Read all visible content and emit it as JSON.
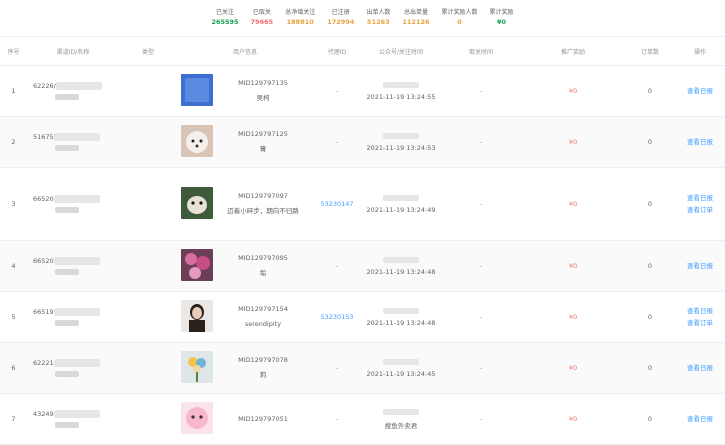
{
  "stats": [
    {
      "label": "已关注",
      "value": "265595",
      "color": "#14a44d"
    },
    {
      "label": "已取关",
      "value": "79665",
      "color": "#f56c6c"
    },
    {
      "label": "总净增关注",
      "value": "188810",
      "color": "#e6a23c"
    },
    {
      "label": "已注册",
      "value": "172994",
      "color": "#e6a23c"
    },
    {
      "label": "出单人数",
      "value": "51263",
      "color": "#e6a23c"
    },
    {
      "label": "总出单量",
      "value": "112126",
      "color": "#e6a23c"
    },
    {
      "label": "累计奖励人数",
      "value": "0",
      "color": "#e6a23c"
    },
    {
      "label": "累计奖励",
      "value": "¥0",
      "color": "#14a44d"
    }
  ],
  "columns": [
    "序号",
    "渠道ID/名称",
    "类型",
    "用户信息",
    "代理ID",
    "公众号/关注时间",
    "取关时间",
    "推广奖励",
    "订单数",
    "操作"
  ],
  "rows": [
    {
      "idx": "1",
      "cid": "62226/",
      "uid": "MID129797135",
      "uname": "吴柯",
      "agent": "-",
      "time": "2021-11-19 13:24:55",
      "unfollow": "-",
      "reward": "¥0",
      "orders": "0",
      "ops": [
        "查看日报"
      ],
      "avatar": "blue"
    },
    {
      "idx": "2",
      "cid": "51675",
      "uid": "MID129797125",
      "uname": "箐",
      "agent": "-",
      "time": "2021-11-19 13:24:53",
      "unfollow": "-",
      "reward": "¥0",
      "orders": "0",
      "ops": [
        "查看日报"
      ],
      "avatar": "dog"
    },
    {
      "idx": "3",
      "cid": "66520",
      "uid": "MID129797097",
      "uname": "迈着小碎步，期向不归路",
      "agent": "53230147",
      "time": "2021-11-19 13:24:49",
      "unfollow": "-",
      "reward": "¥0",
      "orders": "0",
      "ops": [
        "查看日报",
        "查看订单"
      ],
      "avatar": "cat"
    },
    {
      "idx": "4",
      "cid": "66520",
      "uid": "MID129797095",
      "uname": "垢",
      "agent": "-",
      "time": "2021-11-19 13:24:48",
      "unfollow": "-",
      "reward": "¥0",
      "orders": "0",
      "ops": [
        "查看日报"
      ],
      "avatar": "flower"
    },
    {
      "idx": "5",
      "cid": "66519",
      "uid": "MID129797154",
      "uname": "serendipity",
      "agent": "53230153",
      "time": "2021-11-19 13:24:48",
      "unfollow": "-",
      "reward": "¥0",
      "orders": "0",
      "ops": [
        "查看日报",
        "查看订单"
      ],
      "avatar": "girl"
    },
    {
      "idx": "6",
      "cid": "62221",
      "uid": "MID129797078",
      "uname": "莉",
      "agent": "-",
      "time": "2021-11-19 13:24:45",
      "unfollow": "-",
      "reward": "¥0",
      "orders": "0",
      "ops": [
        "查看日报"
      ],
      "avatar": "bouquet"
    },
    {
      "idx": "7",
      "cid": "43249",
      "uid": "MID129797051",
      "uname": "",
      "agent": "-",
      "time": "搜鱼外卖君",
      "unfollow": "-",
      "reward": "¥0",
      "orders": "0",
      "ops": [
        "查看日报"
      ],
      "avatar": "pink"
    }
  ]
}
